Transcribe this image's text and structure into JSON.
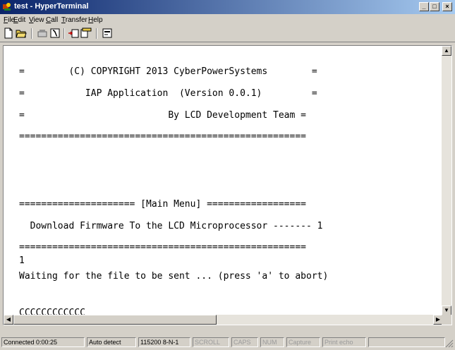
{
  "window": {
    "title": "test - HyperTerminal"
  },
  "menu": [
    {
      "prefix": "",
      "hot": "F",
      "rest": "ile"
    },
    {
      "prefix": "",
      "hot": "E",
      "rest": "dit"
    },
    {
      "prefix": "",
      "hot": "V",
      "rest": "iew"
    },
    {
      "prefix": "",
      "hot": "C",
      "rest": "all"
    },
    {
      "prefix": "",
      "hot": "T",
      "rest": "ransfer"
    },
    {
      "prefix": "",
      "hot": "H",
      "rest": "elp"
    }
  ],
  "terminal": {
    "lines": [
      "=        (C) COPYRIGHT 2013 CyberPowerSystems        =",
      "=           IAP Application  (Version 0.0.1)         =",
      "=                          By LCD Development Team =",
      "====================================================",
      "===================== [Main Menu] ==================",
      "  Download Firmware To the LCD Microprocessor ------- 1",
      "====================================================",
      "1",
      "Waiting for the file to be sent ... (press 'a' to abort)",
      "CCCCCCCCCCCC_"
    ]
  },
  "status": {
    "connected": "Connected 0:00:25",
    "detect": "Auto detect",
    "port": "115200 8-N-1",
    "scroll": "SCROLL",
    "caps": "CAPS",
    "num": "NUM",
    "capture": "Capture",
    "print_echo": "Print echo"
  }
}
